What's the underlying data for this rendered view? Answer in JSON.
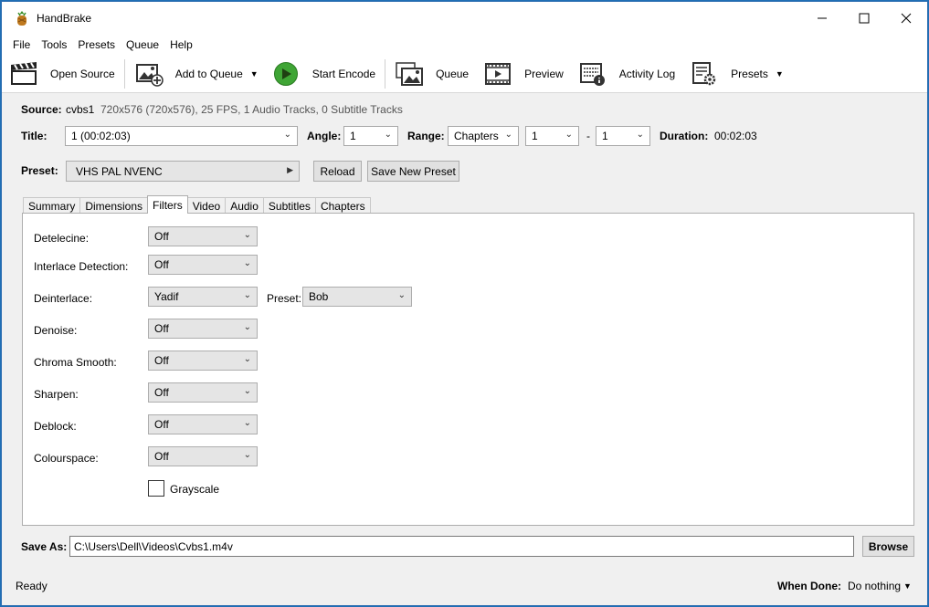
{
  "window": {
    "title": "HandBrake",
    "icon": "pineapple-icon"
  },
  "menu": [
    "File",
    "Tools",
    "Presets",
    "Queue",
    "Help"
  ],
  "toolbar": {
    "open_source": "Open Source",
    "add_to_queue": "Add to Queue",
    "start_encode": "Start Encode",
    "queue": "Queue",
    "preview": "Preview",
    "activity_log": "Activity Log",
    "presets": "Presets"
  },
  "source": {
    "label": "Source:",
    "name": "cvbs1",
    "info": "720x576 (720x576), 25 FPS, 1 Audio Tracks, 0 Subtitle Tracks"
  },
  "title_row": {
    "title_label": "Title:",
    "title_value": "1 (00:02:03)",
    "angle_label": "Angle:",
    "angle_value": "1",
    "range_label": "Range:",
    "range_value": "Chapters",
    "range_start": "1",
    "range_sep": "-",
    "range_end": "1",
    "duration_label": "Duration:",
    "duration_value": "00:02:03"
  },
  "preset_row": {
    "label": "Preset:",
    "value": "VHS PAL NVENC",
    "reload": "Reload",
    "save_new": "Save New Preset"
  },
  "tabs": [
    "Summary",
    "Dimensions",
    "Filters",
    "Video",
    "Audio",
    "Subtitles",
    "Chapters"
  ],
  "active_tab": "Filters",
  "filters": {
    "detelecine": {
      "label": "Detelecine:",
      "value": "Off"
    },
    "interlace": {
      "label": "Interlace Detection:",
      "value": "Off"
    },
    "deinterlace": {
      "label": "Deinterlace:",
      "value": "Yadif",
      "preset_label": "Preset:",
      "preset_value": "Bob"
    },
    "denoise": {
      "label": "Denoise:",
      "value": "Off"
    },
    "chroma": {
      "label": "Chroma Smooth:",
      "value": "Off"
    },
    "sharpen": {
      "label": "Sharpen:",
      "value": "Off"
    },
    "deblock": {
      "label": "Deblock:",
      "value": "Off"
    },
    "colourspace": {
      "label": "Colourspace:",
      "value": "Off"
    },
    "grayscale": {
      "label": "Grayscale",
      "checked": false
    }
  },
  "save_as": {
    "label": "Save As:",
    "path": "C:\\Users\\Dell\\Videos\\Cvbs1.m4v",
    "browse": "Browse"
  },
  "status": {
    "text": "Ready",
    "when_done_label": "When Done:",
    "when_done_value": "Do nothing"
  },
  "colors": {
    "start_green": "#3fa535",
    "window_border": "#2b6cb0"
  }
}
